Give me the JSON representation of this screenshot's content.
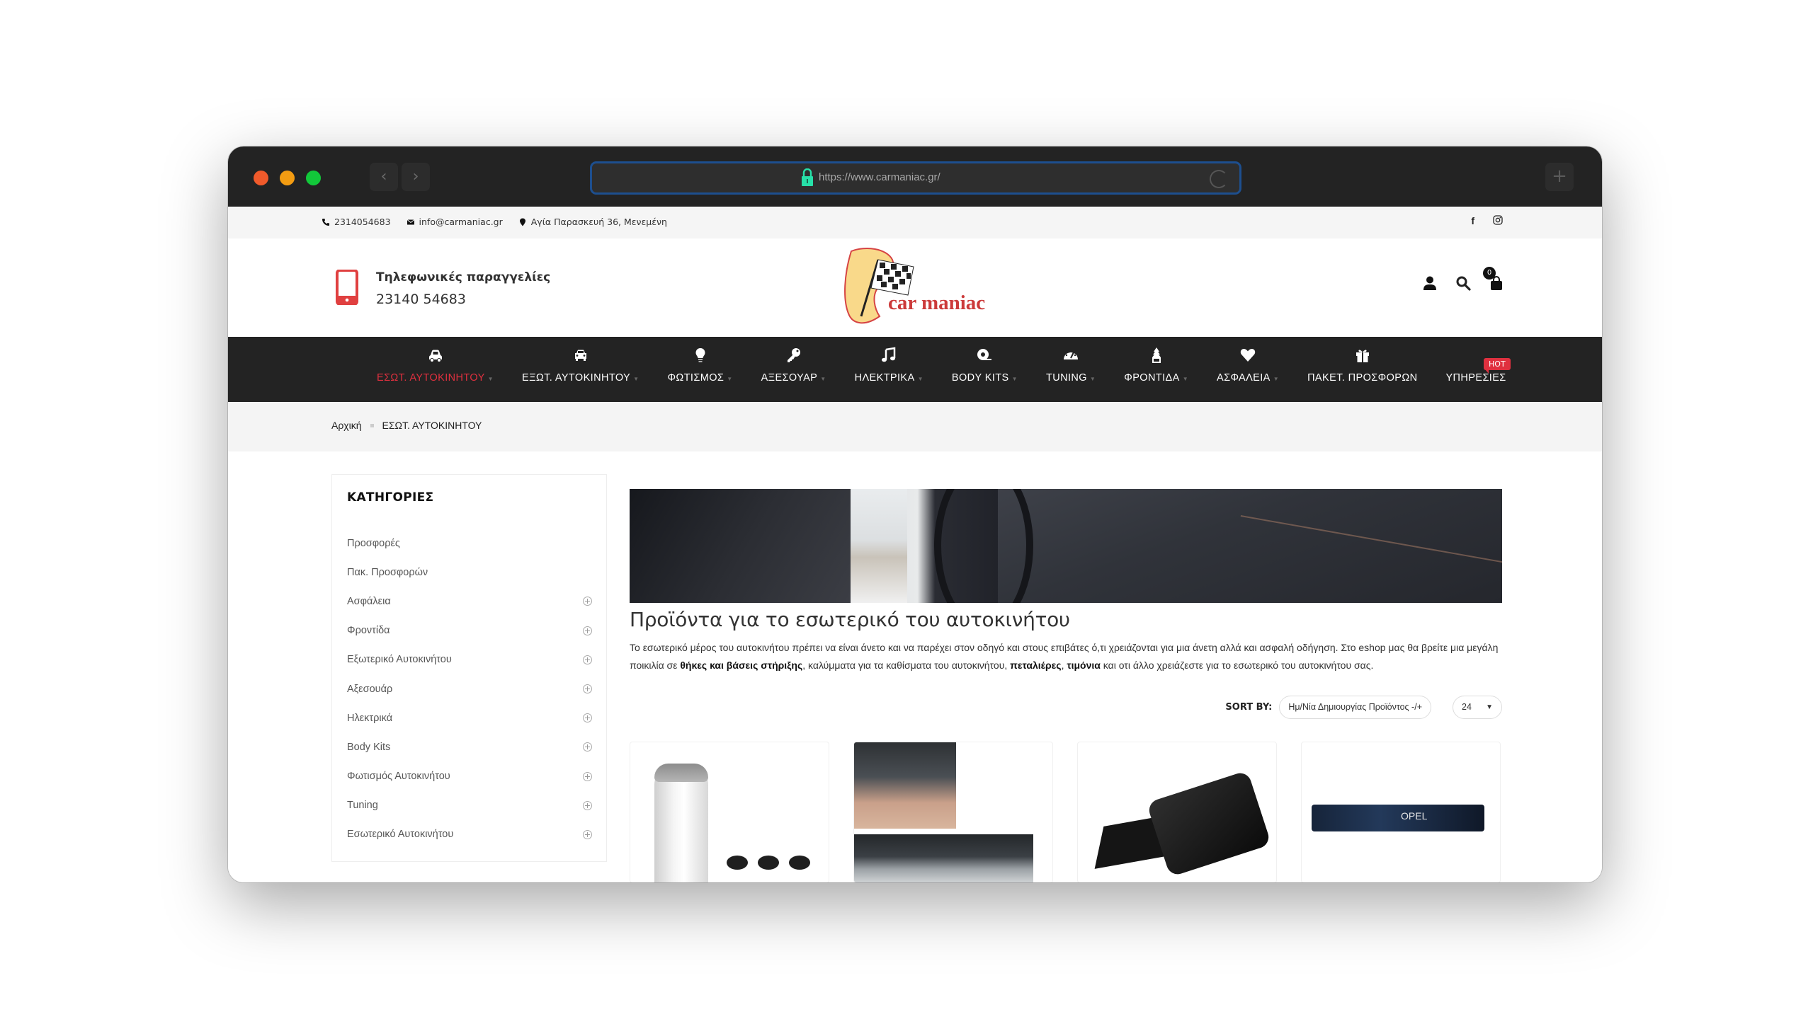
{
  "browser": {
    "url": "https://www.carmaniac.gr/",
    "back_label": "‹",
    "forward_label": "›",
    "new_tab_label": "+"
  },
  "topbar": {
    "phone": "2314054683",
    "email": "info@carmaniac.gr",
    "address": "Αγία Παρασκευή 36, Μενεμένη",
    "social": [
      "facebook",
      "instagram"
    ]
  },
  "header": {
    "phone_orders_label": "Τηλεφωνικές παραγγελίες",
    "phone_orders_number": "23140 54683",
    "logo_text": "car maniac",
    "cart_count": "0",
    "accent_color": "#e0303f"
  },
  "nav": {
    "items": [
      {
        "label": "ΕΣΩΤ. ΑΥΤΟΚΙΝΗΤΟΥ",
        "icon": "car-front-icon",
        "active": true,
        "dropdown": true
      },
      {
        "label": "ΕΞΩΤ. ΑΥΤΟΚΙΝΗΤΟΥ",
        "icon": "car-icon",
        "active": false,
        "dropdown": true
      },
      {
        "label": "ΦΩΤΙΣΜΟΣ",
        "icon": "lightbulb-icon",
        "active": false,
        "dropdown": true
      },
      {
        "label": "ΑΞΕΣΟΥΑΡ",
        "icon": "key-icon",
        "active": false,
        "dropdown": true
      },
      {
        "label": "ΗΛΕΚΤΡΙΚΑ",
        "icon": "music-icon",
        "active": false,
        "dropdown": true
      },
      {
        "label": "BODY KITS",
        "icon": "tape-icon",
        "active": false,
        "dropdown": true
      },
      {
        "label": "TUNING",
        "icon": "speedometer-icon",
        "active": false,
        "dropdown": true
      },
      {
        "label": "ΦΡΟΝΤΙΔΑ",
        "icon": "air-freshener-icon",
        "active": false,
        "dropdown": true
      },
      {
        "label": "ΑΣΦΑΛΕΙΑ",
        "icon": "heart-icon",
        "active": false,
        "dropdown": true
      },
      {
        "label": "ΠΑΚΕΤ. ΠΡΟΣΦΟΡΩΝ",
        "icon": "gift-icon",
        "active": false,
        "dropdown": false
      },
      {
        "label": "ΥΠΗΡΕΣΙΕΣ",
        "icon": "",
        "active": false,
        "dropdown": false,
        "badge": "HOT"
      }
    ]
  },
  "breadcrumb": {
    "items": [
      "Αρχική",
      "ΕΣΩΤ. ΑΥΤΟΚΙΝΗΤΟΥ"
    ]
  },
  "sidebar": {
    "title": "ΚΑΤΗΓΟΡΙΕΣ",
    "items": [
      {
        "label": "Προσφορές",
        "expandable": false
      },
      {
        "label": "Πακ. Προσφορών",
        "expandable": false
      },
      {
        "label": "Ασφάλεια",
        "expandable": true
      },
      {
        "label": "Φροντίδα",
        "expandable": true
      },
      {
        "label": "Εξωτερικό Αυτοκινήτου",
        "expandable": true
      },
      {
        "label": "Αξεσουάρ",
        "expandable": true
      },
      {
        "label": "Ηλεκτρικά",
        "expandable": true
      },
      {
        "label": "Body Kits",
        "expandable": true
      },
      {
        "label": "Φωτισμός Αυτοκινήτου",
        "expandable": true
      },
      {
        "label": "Tuning",
        "expandable": true
      },
      {
        "label": "Εσωτερικό Αυτοκινήτου",
        "expandable": true
      }
    ]
  },
  "main": {
    "title": "Προϊόντα για το εσωτερικό του αυτοκινήτου",
    "description": {
      "part1": "Το εσωτερικό μέρος του αυτοκινήτου πρέπει να είναι άνετο και να παρέχει στον οδηγό και στους επιβάτες ό,τι χρειάζονται για μια άνετη αλλά και ασφαλή οδήγηση. Στο eshop μας θα βρείτε μια μεγάλη ποικιλία σε ",
      "bold1": "θήκες και βάσεις στήριξης",
      "part2": ", καλύμματα για τα καθίσματα του αυτοκινήτου, ",
      "bold2": "πεταλιέρες",
      "part3": ", ",
      "bold3": "τιμόνια",
      "part4": " και οτι άλλο χρειάζεστε για το εσωτερικό του αυτοκινήτου σας."
    },
    "sort_label": "SORT BY:",
    "sort_value": "Ημ/Νία Δημιουργίας Προϊόντος -/+",
    "per_page_value": "24",
    "products": [
      {
        "image": "gear-knob-image"
      },
      {
        "image": "vent-trim-image"
      },
      {
        "image": "armrest-image"
      },
      {
        "image": "seat-gap-filler-opel-image",
        "brand_text": "OPEL"
      }
    ]
  }
}
